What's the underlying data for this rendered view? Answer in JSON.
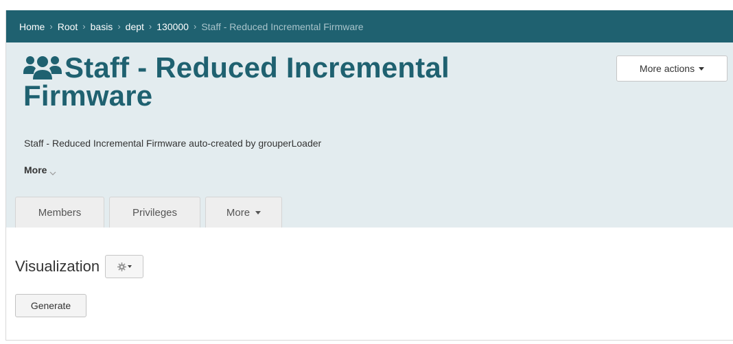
{
  "breadcrumb": {
    "items": [
      "Home",
      "Root",
      "basis",
      "dept",
      "130000"
    ],
    "current": "Staff - Reduced Incremental Firmware",
    "separator": "›"
  },
  "header": {
    "icon": "users-icon",
    "title": "Staff - Reduced Incremental Firmware",
    "more_actions_label": "More actions",
    "description": "Staff - Reduced Incremental Firmware auto-created by grouperLoader",
    "more_toggle_label": "More"
  },
  "tabs": [
    {
      "label": "Members"
    },
    {
      "label": "Privileges"
    },
    {
      "label": "More"
    }
  ],
  "visualization": {
    "title": "Visualization",
    "generate_label": "Generate"
  },
  "colors": {
    "brand": "#1f6170",
    "header_bg": "#e3ecef",
    "muted_link": "#a9c4cb"
  }
}
